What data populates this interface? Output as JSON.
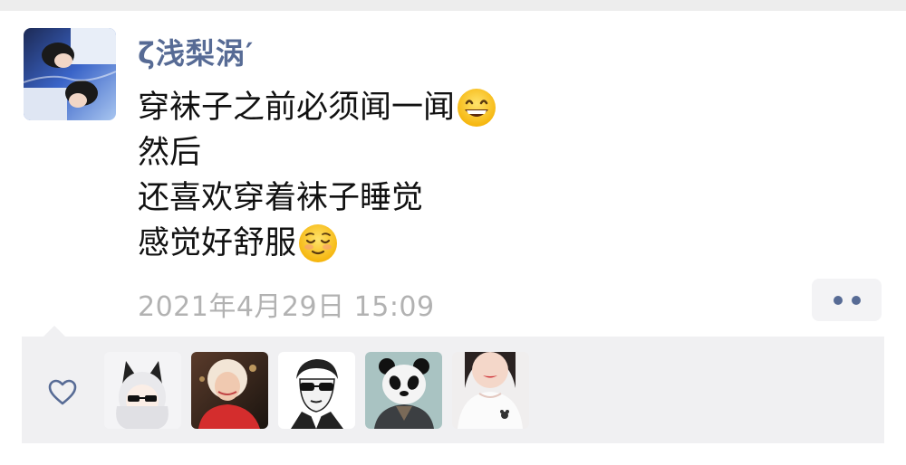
{
  "post": {
    "author": {
      "name": "ζ浅梨涡′",
      "name_color": "#576b95"
    },
    "content_lines": [
      {
        "text": "穿袜子之前必须闻一闻",
        "emoji": "grinning-face-icon"
      },
      {
        "text": "然后",
        "emoji": null
      },
      {
        "text": "还喜欢穿着袜子睡觉",
        "emoji": null
      },
      {
        "text": "感觉好舒服",
        "emoji": "relieved-face-icon"
      }
    ],
    "timestamp": "2021年4月29日 15:09",
    "more_button_icon": "two-dots-icon"
  },
  "likes": {
    "icon": "heart-outline-icon",
    "avatars": [
      "anime-cat-ear-sunglasses-avatar",
      "woman-red-shirt-avatar",
      "man-sunglasses-sketch-avatar",
      "panda-avatar",
      "girl-white-top-avatar"
    ]
  },
  "colors": {
    "link": "#576b95",
    "timestamp": "#b2b2b2",
    "likes_background": "#f0f0f2"
  }
}
